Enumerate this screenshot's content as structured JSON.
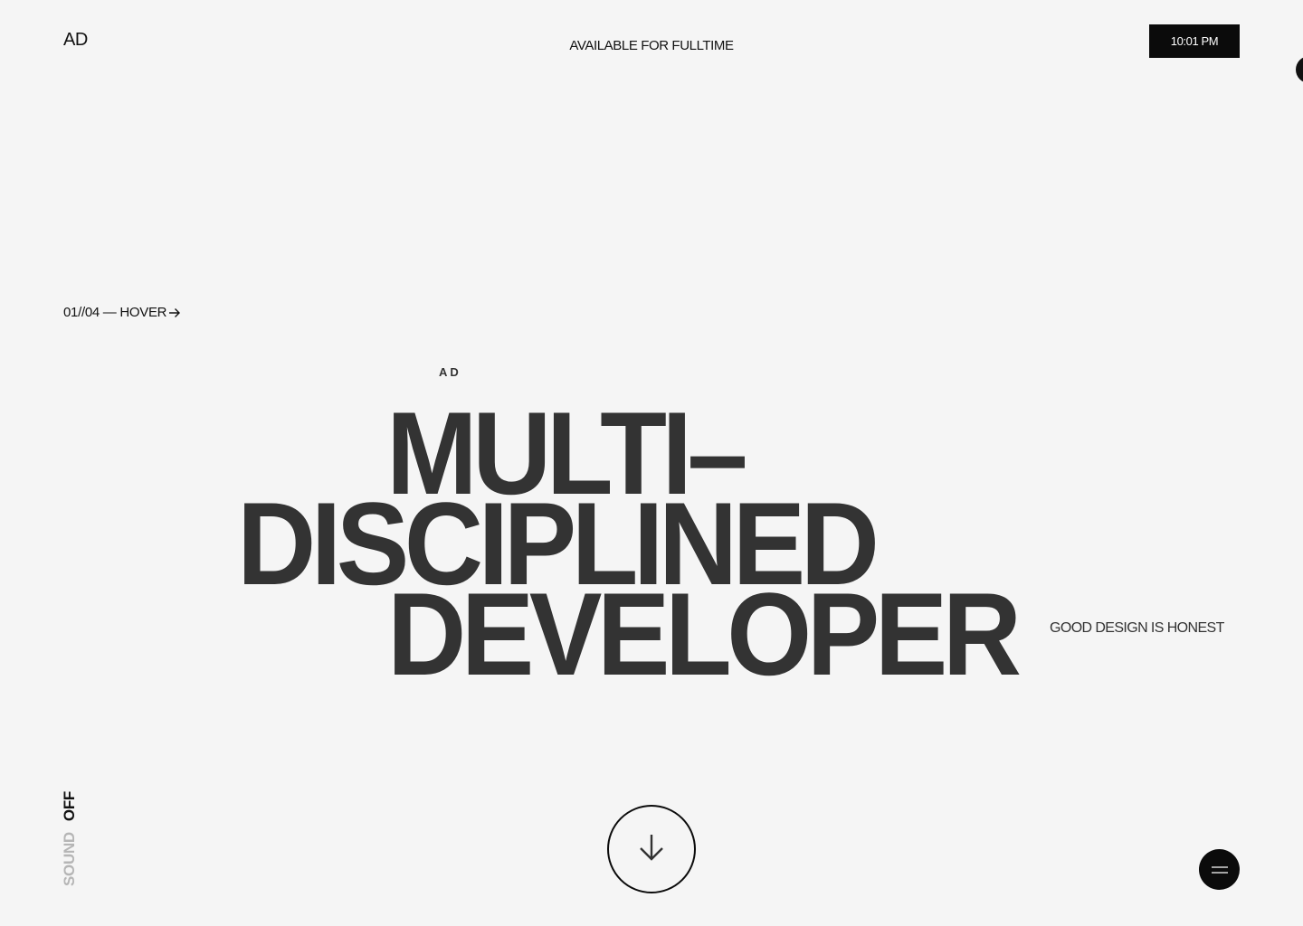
{
  "header": {
    "logo": "AD",
    "availability": "AVAILABLE FOR FULLTIME",
    "clock": "10:01 PM"
  },
  "hero": {
    "counter": "01//04 — HOVER",
    "counter_icon": "arrow-right-icon",
    "mini_label": "AD",
    "headline": [
      "MULTI–",
      "DISCIPLINED",
      "DEVELOPER"
    ],
    "tagline": "GOOD DESIGN IS HONEST"
  },
  "footer": {
    "sound_label": "SOUND",
    "sound_state": "OFF",
    "scroll_icon": "arrow-down-icon",
    "menu_icon": "hamburger-menu-icon"
  },
  "colors": {
    "background": "#f5f5f5",
    "headline": "#333333",
    "accent_dark": "#0b0b0b",
    "muted": "#b5b5b5"
  }
}
